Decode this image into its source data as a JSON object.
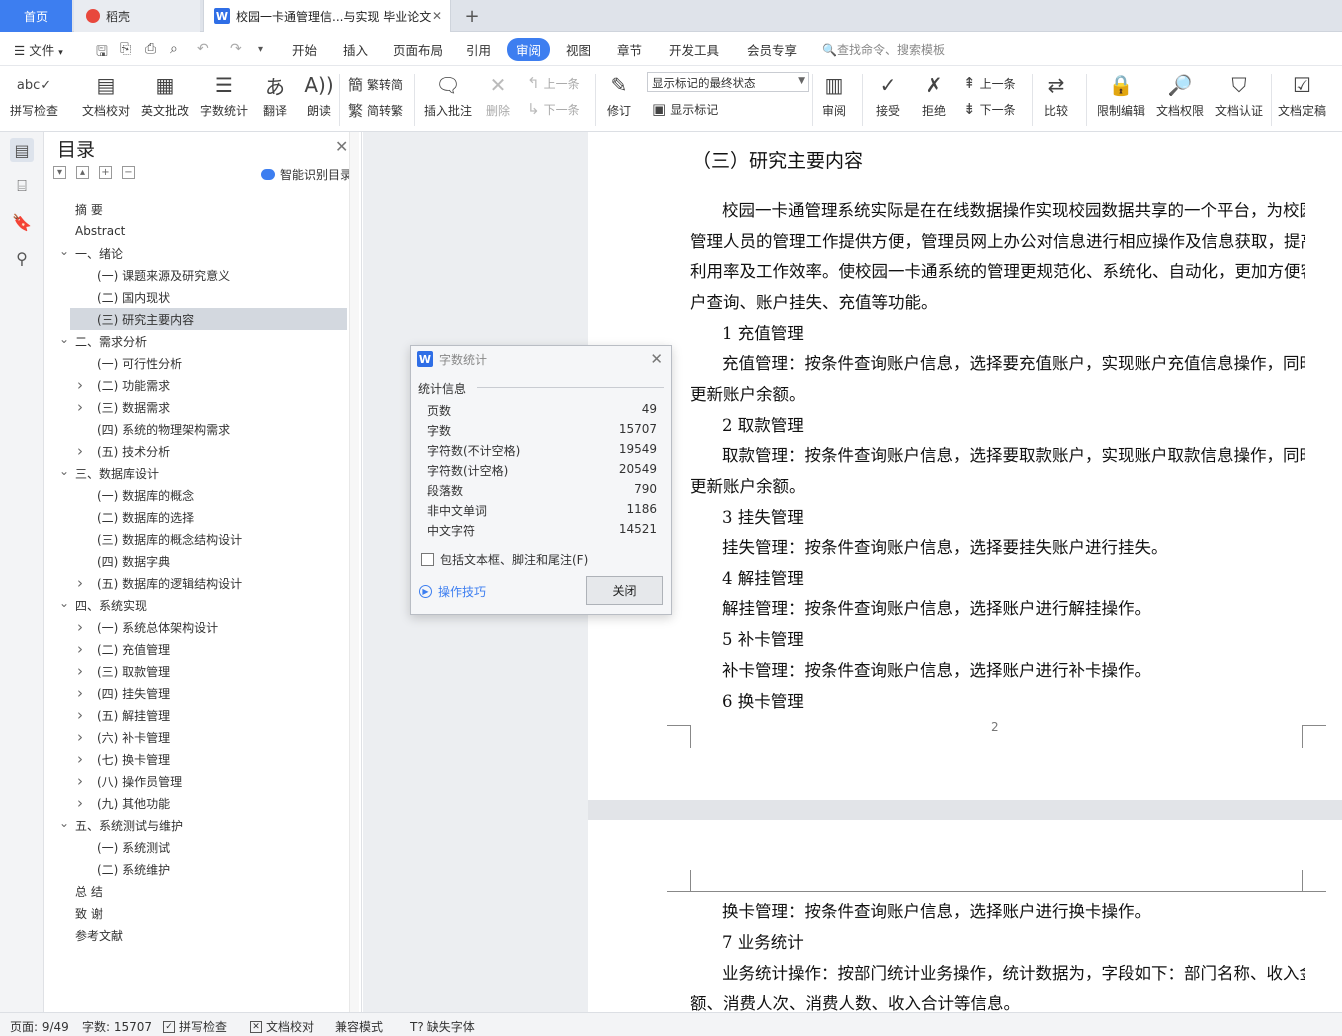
{
  "tabs": {
    "home": "首页",
    "daoke": "稻壳",
    "doc": "校园一卡通管理信...与实现 毕业论文"
  },
  "menu": {
    "file": "文件",
    "items": [
      "开始",
      "插入",
      "页面布局",
      "引用",
      "审阅",
      "视图",
      "章节",
      "开发工具",
      "会员专享"
    ],
    "active": "审阅",
    "search": "查找命令、搜索模板"
  },
  "ribbon": {
    "spell": "拼写检查",
    "proof": "文档校对",
    "en_review": "英文批改",
    "wordcount": "字数统计",
    "translate": "翻译",
    "read": "朗读",
    "to_trad": "繁转简",
    "to_simp": "简转繁",
    "insert_comment": "插入批注",
    "delete": "删除",
    "prev_comment": "上一条",
    "next_comment": "下一条",
    "revise": "修订",
    "markup_state": "显示标记的最终状态",
    "show_markup": "显示标记",
    "review": "审阅",
    "accept": "接受",
    "reject": "拒绝",
    "prev": "上一条",
    "next": "下一条",
    "compare": "比较",
    "restrict": "限制编辑",
    "permission": "文档权限",
    "cert": "文档认证",
    "finalize": "文档定稿"
  },
  "nav": {
    "title": "目录",
    "smart": "智能识别目录",
    "toc": [
      "摘  要",
      "Abstract",
      "一、绪论",
      "(一) 课题来源及研究意义",
      "(二) 国内现状",
      "(三) 研究主要内容",
      "二、需求分析",
      "(一) 可行性分析",
      "(二) 功能需求",
      "(三) 数据需求",
      "(四) 系统的物理架构需求",
      "(五) 技术分析",
      "三、数据库设计",
      "(一) 数据库的概念",
      "(二) 数据库的选择",
      "(三) 数据库的概念结构设计",
      "(四) 数据字典",
      "(五) 数据库的逻辑结构设计",
      "四、系统实现",
      "(一) 系统总体架构设计",
      "(二) 充值管理",
      "(三) 取款管理",
      "(四) 挂失管理",
      "(五) 解挂管理",
      "(六) 补卡管理",
      "(七) 换卡管理",
      "(八) 操作员管理",
      "(九) 其他功能",
      "五、系统测试与维护",
      "(一) 系统测试",
      "(二) 系统维护",
      "总  结",
      "致  谢",
      "参考文献"
    ],
    "selected": "(三) 研究主要内容"
  },
  "doc": {
    "heading": "（三）研究主要内容",
    "lines": [
      "校园一卡通管理系统实际是在在线数据操作实现校园数据共享的一个平台，为校园",
      "管理人员的管理工作提供方便，管理员网上办公对信息进行相应操作及信息获取，提高",
      "利用率及工作效率。使校园一卡通系统的管理更规范化、系统化、自动化，更加方便客",
      "户查询、账户挂失、充值等功能。",
      "1  充值管理",
      "充值管理：按条件查询账户信息，选择要充值账户，实现账户充值信息操作，同时",
      "更新账户余额。",
      "2 取款管理",
      "取款管理：按条件查询账户信息，选择要取款账户，实现账户取款信息操作，同时",
      "更新账户余额。",
      "3 挂失管理",
      "挂失管理：按条件查询账户信息，选择要挂失账户进行挂失。",
      "4 解挂管理",
      "解挂管理：按条件查询账户信息，选择账户进行解挂操作。",
      "5 补卡管理",
      "补卡管理：按条件查询账户信息，选择账户进行补卡操作。",
      "6 换卡管理"
    ],
    "page_number": "2",
    "page2_lines": [
      "换卡管理：按条件查询账户信息，选择账户进行换卡操作。",
      "7  业务统计",
      "业务统计操作：按部门统计业务操作，统计数据为，字段如下：部门名称、收入金",
      "额、消费人次、消费人数、收入合计等信息。"
    ]
  },
  "dialog": {
    "title": "字数统计",
    "group": "统计信息",
    "stats": [
      {
        "label": "页数",
        "value": "49"
      },
      {
        "label": "字数",
        "value": "15707"
      },
      {
        "label": "字符数(不计空格)",
        "value": "19549"
      },
      {
        "label": "字符数(计空格)",
        "value": "20549"
      },
      {
        "label": "段落数",
        "value": "790"
      },
      {
        "label": "非中文单词",
        "value": "1186"
      },
      {
        "label": "中文字符",
        "value": "14521"
      }
    ],
    "include": "包括文本框、脚注和尾注(F)",
    "tips": "操作技巧",
    "close": "关闭"
  },
  "status": {
    "page": "页面: 9/49",
    "words": "字数: 15707",
    "spell": "拼写检查",
    "proof": "文档校对",
    "compat": "兼容模式",
    "missing_font": "缺失字体"
  },
  "colors": {
    "accent": "#3d7ef0"
  }
}
